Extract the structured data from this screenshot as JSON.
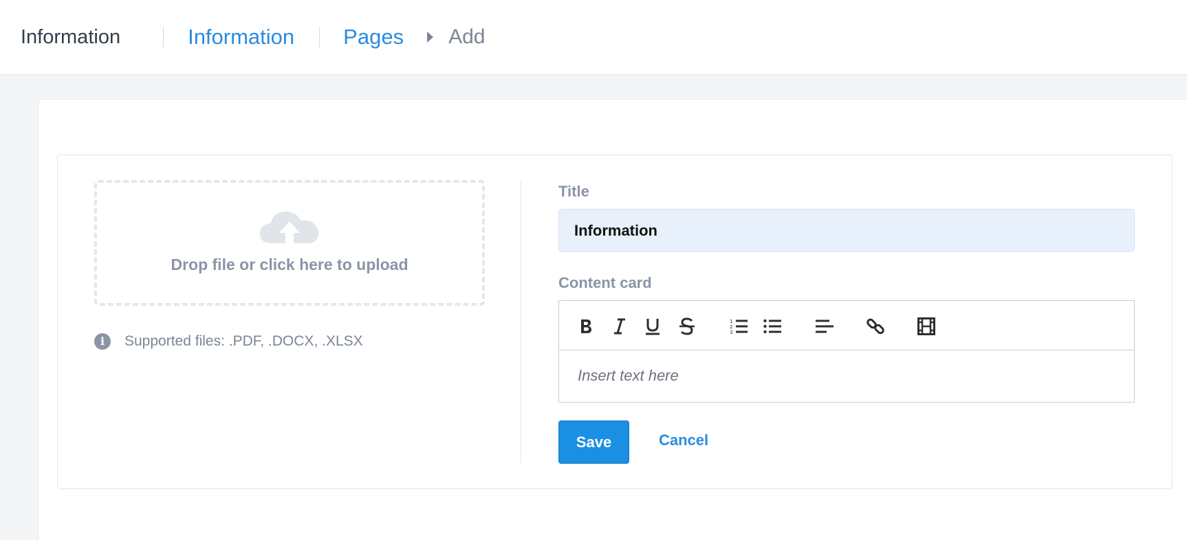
{
  "header": {
    "app_title": "Information",
    "breadcrumb": [
      {
        "label": "Information"
      },
      {
        "label": "Pages"
      }
    ],
    "current": "Add"
  },
  "upload": {
    "drop_text": "Drop file or click here to upload",
    "icon": "cloud-upload-icon",
    "supported_text": "Supported files: .PDF, .DOCX, .XLSX"
  },
  "form": {
    "title_label": "Title",
    "title_value": "Information",
    "content_label": "Content card",
    "editor_placeholder": "Insert text here",
    "toolbar": [
      "bold-icon",
      "italic-icon",
      "underline-icon",
      "strikethrough-icon",
      "ordered-list-icon",
      "bullet-list-icon",
      "align-left-icon",
      "link-icon",
      "video-icon"
    ],
    "save_label": "Save",
    "cancel_label": "Cancel"
  },
  "colors": {
    "accent": "#2a8be0",
    "primary_button": "#1a8fe3",
    "input_bg": "#e8f0fc",
    "page_bg": "#f4f5f7"
  }
}
